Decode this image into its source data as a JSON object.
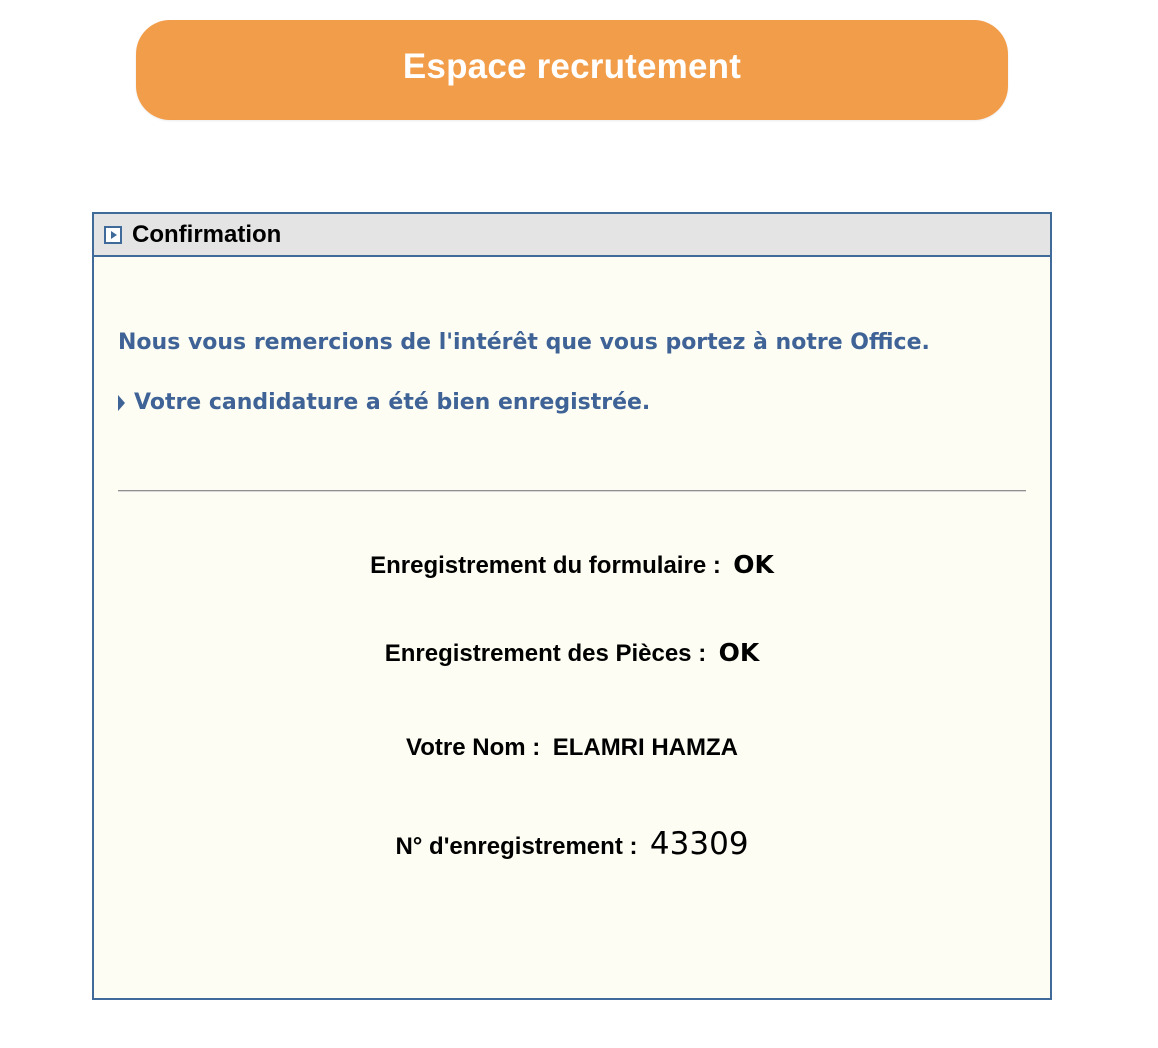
{
  "header": {
    "title": "Espace recrutement",
    "accent_color": "#f29d4a"
  },
  "panel": {
    "title": "Confirmation",
    "title_icon": "play-arrow-icon",
    "border_color": "#3f6a9a",
    "thanks_message": "Nous vous remercions de l'intérêt que vous portez à notre Office.",
    "registered_icon": "caret-right-icon",
    "registered_message": "Votre candidature a été bien enregistrée.",
    "text_color": "#3f6396",
    "rows": [
      {
        "label": "Enregistrement du formulaire :",
        "value": "OK"
      },
      {
        "label": "Enregistrement des Pièces :",
        "value": "OK"
      },
      {
        "label": "Votre Nom :",
        "value": "ELAMRI HAMZA"
      },
      {
        "label": "N° d'enregistrement :",
        "value": "43309"
      }
    ]
  }
}
